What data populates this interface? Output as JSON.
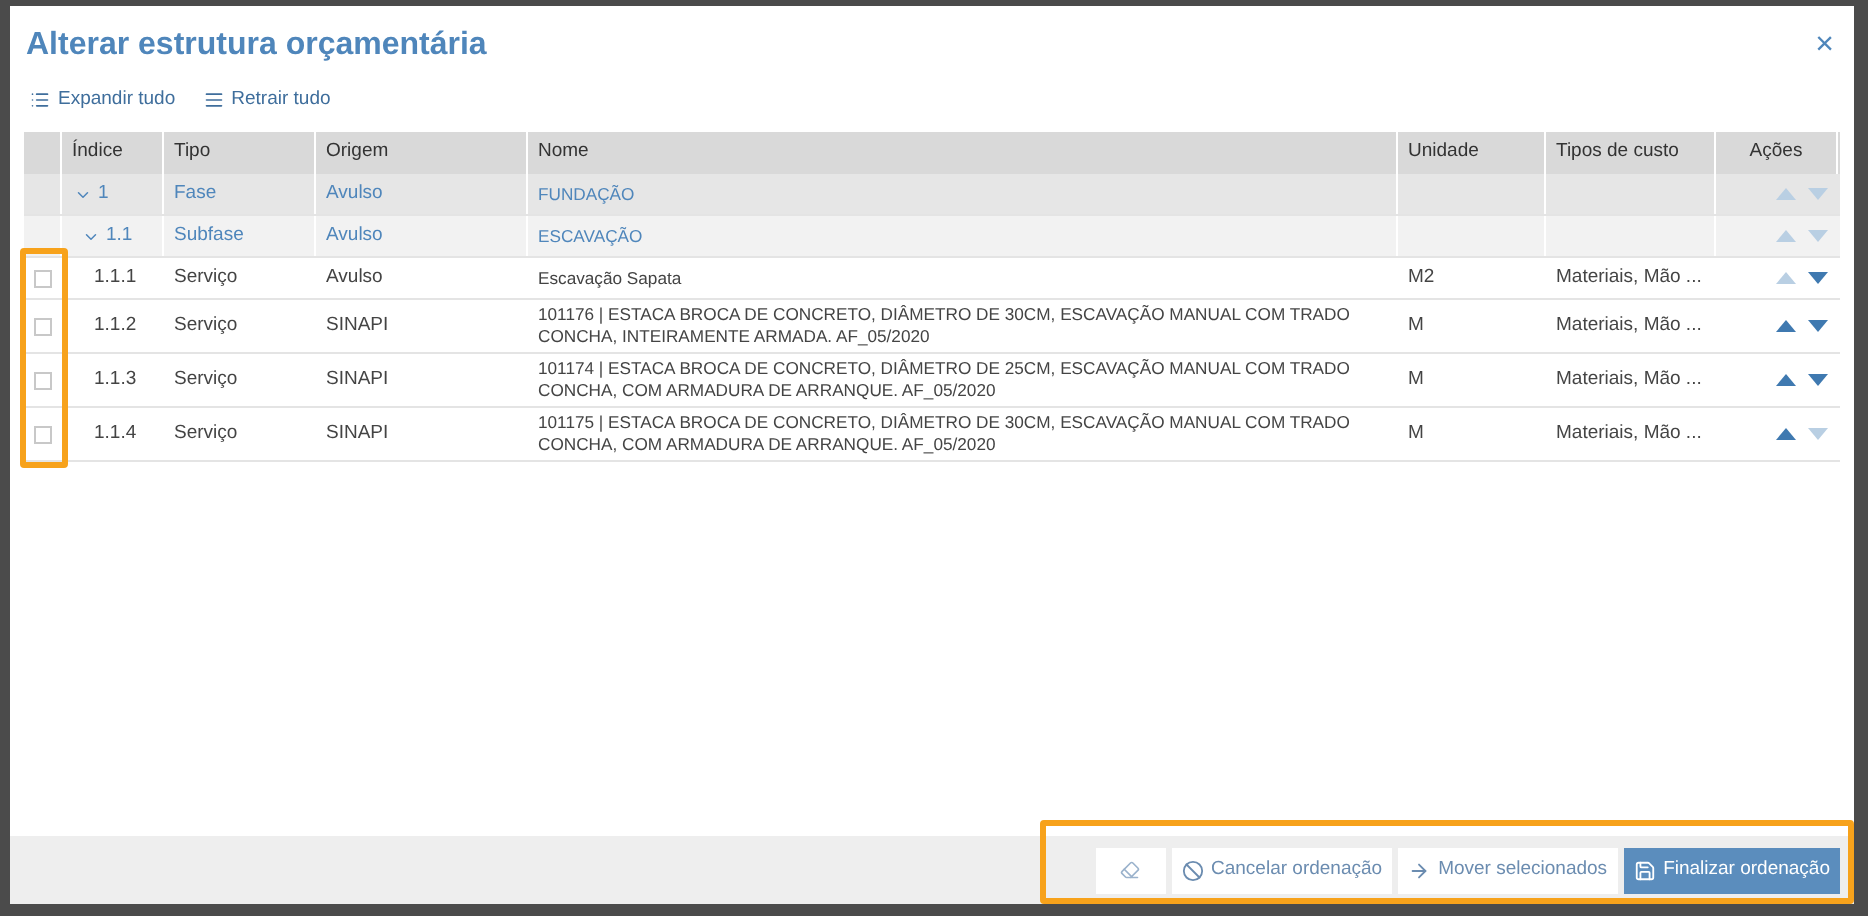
{
  "dialog": {
    "title": "Alterar estrutura orçamentária",
    "close": "×"
  },
  "toolbar": [
    {
      "kind": "expand",
      "label": "Expandir tudo"
    },
    {
      "kind": "collapse",
      "label": "Retrair tudo"
    }
  ],
  "table": {
    "columns": [
      "Índice",
      "Tipo",
      "Origem",
      "Nome",
      "Unidade",
      "Tipos de custo",
      "Ações"
    ],
    "rows": [
      {
        "kind": "phase",
        "index": "1",
        "tipo": "Fase",
        "origem": "Avulso",
        "nome": "FUNDAÇÃO",
        "up_enabled": false,
        "down_enabled": false
      },
      {
        "kind": "subphase",
        "index": "1.1",
        "tipo": "Subfase",
        "origem": "Avulso",
        "nome": "ESCAVAÇÃO",
        "up_enabled": false,
        "down_enabled": false
      },
      {
        "kind": "item",
        "checked": false,
        "index": "1.1.1",
        "tipo": "Serviço",
        "origem": "Avulso",
        "nome": "Escavação Sapata",
        "unidade": "M2",
        "custo": "Materiais, Mão ...",
        "up_enabled": false,
        "down_enabled": true
      },
      {
        "kind": "item",
        "checked": false,
        "index": "1.1.2",
        "tipo": "Serviço",
        "origem": "SINAPI",
        "nome": "101176 | ESTACA BROCA DE CONCRETO, DIÂMETRO DE 30CM, ESCAVAÇÃO MANUAL COM TRADO CONCHA, INTEIRAMENTE ARMADA. AF_05/2020",
        "unidade": "M",
        "custo": "Materiais, Mão ...",
        "up_enabled": true,
        "down_enabled": true
      },
      {
        "kind": "item",
        "checked": false,
        "index": "1.1.3",
        "tipo": "Serviço",
        "origem": "SINAPI",
        "nome": "101174 | ESTACA BROCA DE CONCRETO, DIÂMETRO DE 25CM, ESCAVAÇÃO MANUAL COM TRADO CONCHA, COM ARMADURA DE ARRANQUE. AF_05/2020",
        "unidade": "M",
        "custo": "Materiais, Mão ...",
        "up_enabled": true,
        "down_enabled": true
      },
      {
        "kind": "item",
        "checked": false,
        "index": "1.1.4",
        "tipo": "Serviço",
        "origem": "SINAPI",
        "nome": "101175 | ESTACA BROCA DE CONCRETO, DIÂMETRO DE 30CM, ESCAVAÇÃO MANUAL COM TRADO CONCHA, COM ARMADURA DE ARRANQUE. AF_05/2020",
        "unidade": "M",
        "custo": "Materiais, Mão ...",
        "up_enabled": true,
        "down_enabled": false
      }
    ]
  },
  "footer": [
    {
      "kind": "eraser"
    },
    {
      "kind": "cancel",
      "label": "Cancelar ordenação"
    },
    {
      "kind": "move",
      "label": "Mover selecionados"
    },
    {
      "kind": "save",
      "label": "Finalizar ordenação"
    }
  ]
}
